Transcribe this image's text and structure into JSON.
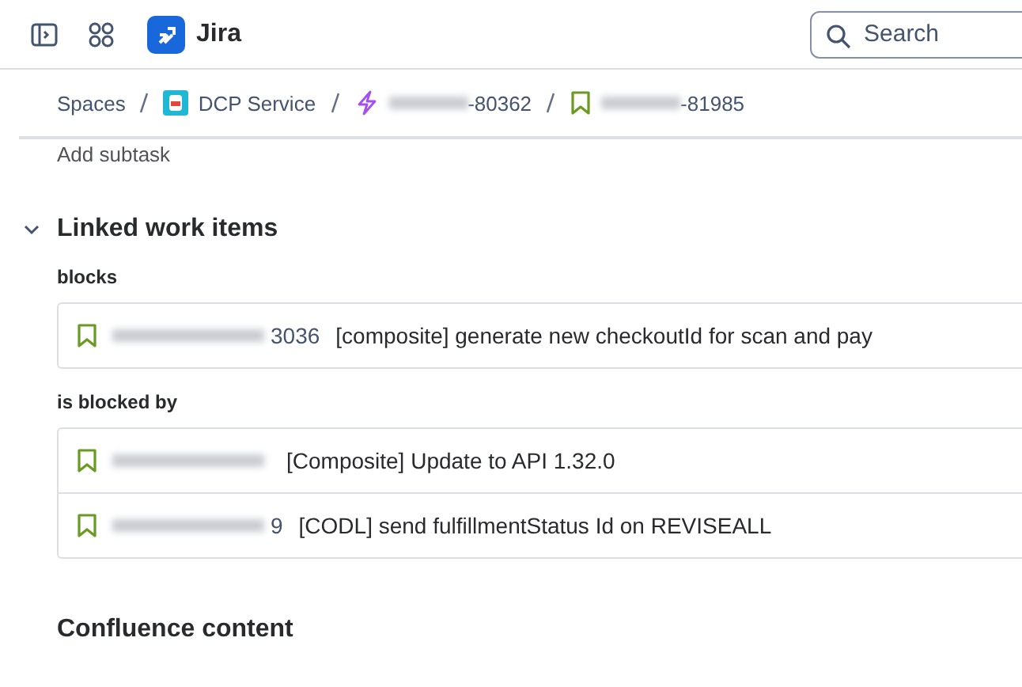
{
  "header": {
    "product": "Jira",
    "search": {
      "placeholder": "Search"
    }
  },
  "breadcrumbs": [
    {
      "label": "Spaces",
      "kind": "text"
    },
    {
      "label": "DCP Service",
      "kind": "space"
    },
    {
      "label": "-80362",
      "kind": "epic"
    },
    {
      "label": "-81985",
      "kind": "story"
    }
  ],
  "add_subtask": "Add subtask",
  "linked": {
    "title": "Linked work items",
    "expanded": true,
    "groups": [
      {
        "label": "blocks",
        "items": [
          {
            "key": "3036",
            "summary": "[composite] generate new checkoutId for scan and pay"
          }
        ]
      },
      {
        "label": "is blocked by",
        "items": [
          {
            "summary": "[Composite] Update to API 1.32.0"
          },
          {
            "key": "9",
            "summary": "[CODL] send fulfillmentStatus Id on REVISEALL"
          }
        ]
      }
    ]
  },
  "confluence": {
    "title": "Confluence content"
  }
}
